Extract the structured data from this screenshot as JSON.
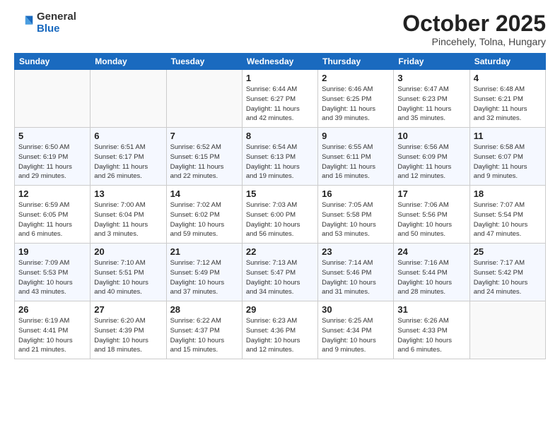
{
  "header": {
    "logo_general": "General",
    "logo_blue": "Blue",
    "month_title": "October 2025",
    "location": "Pincehely, Tolna, Hungary"
  },
  "days_of_week": [
    "Sunday",
    "Monday",
    "Tuesday",
    "Wednesday",
    "Thursday",
    "Friday",
    "Saturday"
  ],
  "weeks": [
    [
      {
        "day": "",
        "info": ""
      },
      {
        "day": "",
        "info": ""
      },
      {
        "day": "",
        "info": ""
      },
      {
        "day": "1",
        "info": "Sunrise: 6:44 AM\nSunset: 6:27 PM\nDaylight: 11 hours\nand 42 minutes."
      },
      {
        "day": "2",
        "info": "Sunrise: 6:46 AM\nSunset: 6:25 PM\nDaylight: 11 hours\nand 39 minutes."
      },
      {
        "day": "3",
        "info": "Sunrise: 6:47 AM\nSunset: 6:23 PM\nDaylight: 11 hours\nand 35 minutes."
      },
      {
        "day": "4",
        "info": "Sunrise: 6:48 AM\nSunset: 6:21 PM\nDaylight: 11 hours\nand 32 minutes."
      }
    ],
    [
      {
        "day": "5",
        "info": "Sunrise: 6:50 AM\nSunset: 6:19 PM\nDaylight: 11 hours\nand 29 minutes."
      },
      {
        "day": "6",
        "info": "Sunrise: 6:51 AM\nSunset: 6:17 PM\nDaylight: 11 hours\nand 26 minutes."
      },
      {
        "day": "7",
        "info": "Sunrise: 6:52 AM\nSunset: 6:15 PM\nDaylight: 11 hours\nand 22 minutes."
      },
      {
        "day": "8",
        "info": "Sunrise: 6:54 AM\nSunset: 6:13 PM\nDaylight: 11 hours\nand 19 minutes."
      },
      {
        "day": "9",
        "info": "Sunrise: 6:55 AM\nSunset: 6:11 PM\nDaylight: 11 hours\nand 16 minutes."
      },
      {
        "day": "10",
        "info": "Sunrise: 6:56 AM\nSunset: 6:09 PM\nDaylight: 11 hours\nand 12 minutes."
      },
      {
        "day": "11",
        "info": "Sunrise: 6:58 AM\nSunset: 6:07 PM\nDaylight: 11 hours\nand 9 minutes."
      }
    ],
    [
      {
        "day": "12",
        "info": "Sunrise: 6:59 AM\nSunset: 6:05 PM\nDaylight: 11 hours\nand 6 minutes."
      },
      {
        "day": "13",
        "info": "Sunrise: 7:00 AM\nSunset: 6:04 PM\nDaylight: 11 hours\nand 3 minutes."
      },
      {
        "day": "14",
        "info": "Sunrise: 7:02 AM\nSunset: 6:02 PM\nDaylight: 10 hours\nand 59 minutes."
      },
      {
        "day": "15",
        "info": "Sunrise: 7:03 AM\nSunset: 6:00 PM\nDaylight: 10 hours\nand 56 minutes."
      },
      {
        "day": "16",
        "info": "Sunrise: 7:05 AM\nSunset: 5:58 PM\nDaylight: 10 hours\nand 53 minutes."
      },
      {
        "day": "17",
        "info": "Sunrise: 7:06 AM\nSunset: 5:56 PM\nDaylight: 10 hours\nand 50 minutes."
      },
      {
        "day": "18",
        "info": "Sunrise: 7:07 AM\nSunset: 5:54 PM\nDaylight: 10 hours\nand 47 minutes."
      }
    ],
    [
      {
        "day": "19",
        "info": "Sunrise: 7:09 AM\nSunset: 5:53 PM\nDaylight: 10 hours\nand 43 minutes."
      },
      {
        "day": "20",
        "info": "Sunrise: 7:10 AM\nSunset: 5:51 PM\nDaylight: 10 hours\nand 40 minutes."
      },
      {
        "day": "21",
        "info": "Sunrise: 7:12 AM\nSunset: 5:49 PM\nDaylight: 10 hours\nand 37 minutes."
      },
      {
        "day": "22",
        "info": "Sunrise: 7:13 AM\nSunset: 5:47 PM\nDaylight: 10 hours\nand 34 minutes."
      },
      {
        "day": "23",
        "info": "Sunrise: 7:14 AM\nSunset: 5:46 PM\nDaylight: 10 hours\nand 31 minutes."
      },
      {
        "day": "24",
        "info": "Sunrise: 7:16 AM\nSunset: 5:44 PM\nDaylight: 10 hours\nand 28 minutes."
      },
      {
        "day": "25",
        "info": "Sunrise: 7:17 AM\nSunset: 5:42 PM\nDaylight: 10 hours\nand 24 minutes."
      }
    ],
    [
      {
        "day": "26",
        "info": "Sunrise: 6:19 AM\nSunset: 4:41 PM\nDaylight: 10 hours\nand 21 minutes."
      },
      {
        "day": "27",
        "info": "Sunrise: 6:20 AM\nSunset: 4:39 PM\nDaylight: 10 hours\nand 18 minutes."
      },
      {
        "day": "28",
        "info": "Sunrise: 6:22 AM\nSunset: 4:37 PM\nDaylight: 10 hours\nand 15 minutes."
      },
      {
        "day": "29",
        "info": "Sunrise: 6:23 AM\nSunset: 4:36 PM\nDaylight: 10 hours\nand 12 minutes."
      },
      {
        "day": "30",
        "info": "Sunrise: 6:25 AM\nSunset: 4:34 PM\nDaylight: 10 hours\nand 9 minutes."
      },
      {
        "day": "31",
        "info": "Sunrise: 6:26 AM\nSunset: 4:33 PM\nDaylight: 10 hours\nand 6 minutes."
      },
      {
        "day": "",
        "info": ""
      }
    ]
  ]
}
